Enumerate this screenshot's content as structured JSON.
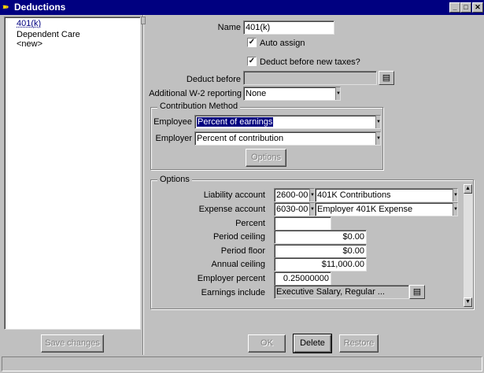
{
  "window": {
    "title": "Deductions",
    "minimize": "_",
    "maximize": "□",
    "close": "✕"
  },
  "list": {
    "items": [
      "401(k)",
      "Dependent Care",
      "<new>"
    ]
  },
  "form": {
    "name_label": "Name",
    "name_value": "401(k)",
    "auto_assign_label": "Auto assign",
    "auto_assign_checked": "✓",
    "deduct_before_taxes_label": "Deduct before new taxes?",
    "deduct_before_taxes_checked": "✓",
    "deduct_before_label": "Deduct before",
    "deduct_before_value": "",
    "w2_label": "Additional W-2 reporting",
    "w2_value": "None"
  },
  "contribution": {
    "title": "Contribution Method",
    "employee_label": "Employee",
    "employee_value": "Percent of earnings",
    "employer_label": "Employer",
    "employer_value": "Percent of contribution",
    "options_button": "Options"
  },
  "options": {
    "title": "Options",
    "liability_label": "Liability account",
    "liability_code": "2600-00",
    "liability_name": "401K Contributions",
    "expense_label": "Expense account",
    "expense_code": "6030-00",
    "expense_name": "Employer 401K Expense",
    "percent_label": "Percent",
    "percent_value": "",
    "period_ceiling_label": "Period ceiling",
    "period_ceiling_value": "$0.00",
    "period_floor_label": "Period floor",
    "period_floor_value": "$0.00",
    "annual_ceiling_label": "Annual ceiling",
    "annual_ceiling_value": "$11,000.00",
    "employer_percent_label": "Employer percent",
    "employer_percent_value": "0.25000000",
    "earnings_include_label": "Earnings include",
    "earnings_include_value": "Executive Salary, Regular ..."
  },
  "buttons": {
    "save_changes": "Save changes",
    "ok": "OK",
    "delete": "Delete",
    "restore": "Restore"
  }
}
